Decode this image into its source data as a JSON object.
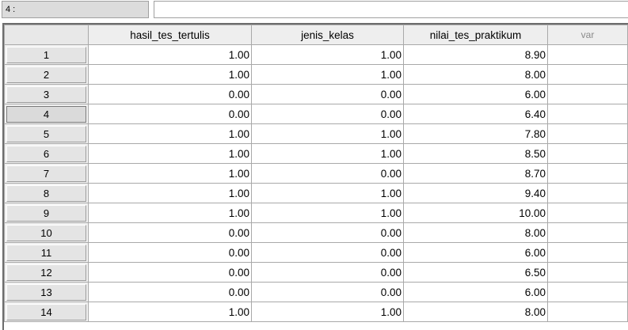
{
  "editor": {
    "cell_ref": "4 :",
    "cell_value": ""
  },
  "columns": [
    "hasil_tes_tertulis",
    "jenis_kelas",
    "nilai_tes_praktikum",
    "var"
  ],
  "rows": [
    {
      "id": "1",
      "cells": [
        "1.00",
        "1.00",
        "8.90"
      ]
    },
    {
      "id": "2",
      "cells": [
        "1.00",
        "1.00",
        "8.00"
      ]
    },
    {
      "id": "3",
      "cells": [
        "0.00",
        "0.00",
        "6.00"
      ]
    },
    {
      "id": "4",
      "cells": [
        "0.00",
        "0.00",
        "6.40"
      ]
    },
    {
      "id": "5",
      "cells": [
        "1.00",
        "1.00",
        "7.80"
      ]
    },
    {
      "id": "6",
      "cells": [
        "1.00",
        "1.00",
        "8.50"
      ]
    },
    {
      "id": "7",
      "cells": [
        "1.00",
        "0.00",
        "8.70"
      ]
    },
    {
      "id": "8",
      "cells": [
        "1.00",
        "1.00",
        "9.40"
      ]
    },
    {
      "id": "9",
      "cells": [
        "1.00",
        "1.00",
        "10.00"
      ]
    },
    {
      "id": "10",
      "cells": [
        "0.00",
        "0.00",
        "8.00"
      ]
    },
    {
      "id": "11",
      "cells": [
        "0.00",
        "0.00",
        "6.00"
      ]
    },
    {
      "id": "12",
      "cells": [
        "0.00",
        "0.00",
        "6.50"
      ]
    },
    {
      "id": "13",
      "cells": [
        "0.00",
        "0.00",
        "6.00"
      ]
    },
    {
      "id": "14",
      "cells": [
        "1.00",
        "1.00",
        "8.00"
      ]
    }
  ],
  "selected_row": "4"
}
